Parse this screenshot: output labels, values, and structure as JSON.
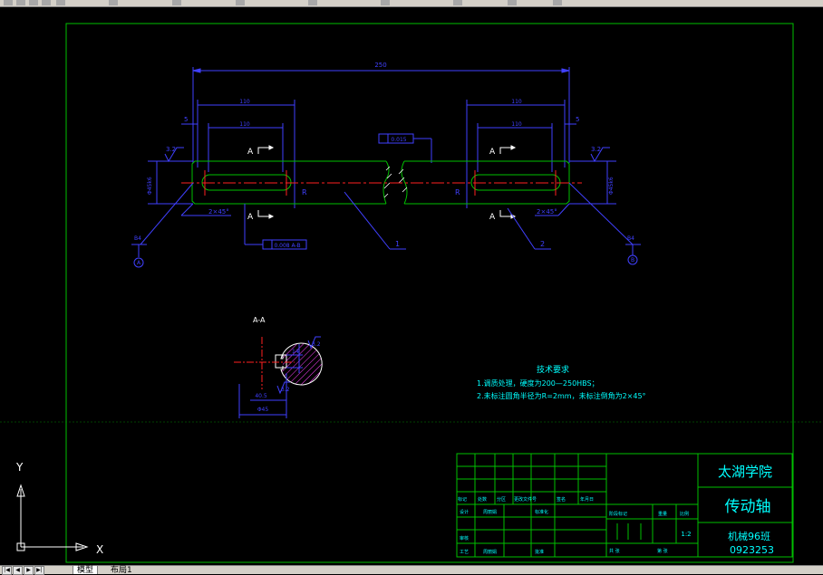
{
  "drawing": {
    "overall_dim": "250",
    "left_key": {
      "dim_outer": "110",
      "dim_inner": "110",
      "offset": "5",
      "section": "A"
    },
    "right_key": {
      "dim_outer": "110",
      "dim_inner": "110",
      "offset": "5",
      "section": "A"
    },
    "roughness_left": "3.2",
    "roughness_right": "3.2",
    "diameter_left": "Φ45k6",
    "diameter_right": "Φ45k6",
    "chamfer_left": "2×45°",
    "chamfer_right": "2×45°",
    "key_label_r": "R",
    "tolerance_box": "0.015",
    "cylindricity": "0.008 A-B",
    "datum_left": "B4",
    "datum_right": "B4",
    "datum_left_circle": "A",
    "datum_right_circle": "B",
    "leader_1": "1",
    "leader_2": "2"
  },
  "section_view": {
    "title": "A-A",
    "dim_depth": "40.5",
    "dim_width": "14",
    "dim_overall": "Φ45",
    "roughness_top": "3.2",
    "roughness_bottom": "3.2"
  },
  "tech_requirements": {
    "heading": "技术要求",
    "line1": "1.调质处理，硬度为200—250HBS；",
    "line2": "2.未标注圆角半径为R=2mm，未标注倒角为2×45°"
  },
  "title_block": {
    "school": "太湖学院",
    "part_name": "传动轴",
    "class_name": "机械96班",
    "drawing_no": "0923253",
    "scale": "1:2",
    "row_labels": [
      "标记",
      "处数",
      "分区",
      "更改文件号",
      "签名",
      "年月日"
    ],
    "design": "设计",
    "design_name": "周丽娟",
    "standard": "标准化",
    "review": "审核",
    "process": "工艺",
    "process_name": "周丽娟",
    "approve": "批准",
    "stage_label": "阶段标记",
    "weight_label": "重量",
    "scale_label": "比例",
    "sheet_total": "共 张",
    "sheet_no": "第 张"
  },
  "ucs": {
    "x_label": "X",
    "y_label": "Y"
  },
  "tabs": {
    "model": "模型",
    "layout": "布局1"
  },
  "colors": {
    "frame": "#00c000",
    "dim": "#4040ff",
    "center": "#ff2020",
    "text": "#00ffff",
    "white": "#ffffff"
  }
}
